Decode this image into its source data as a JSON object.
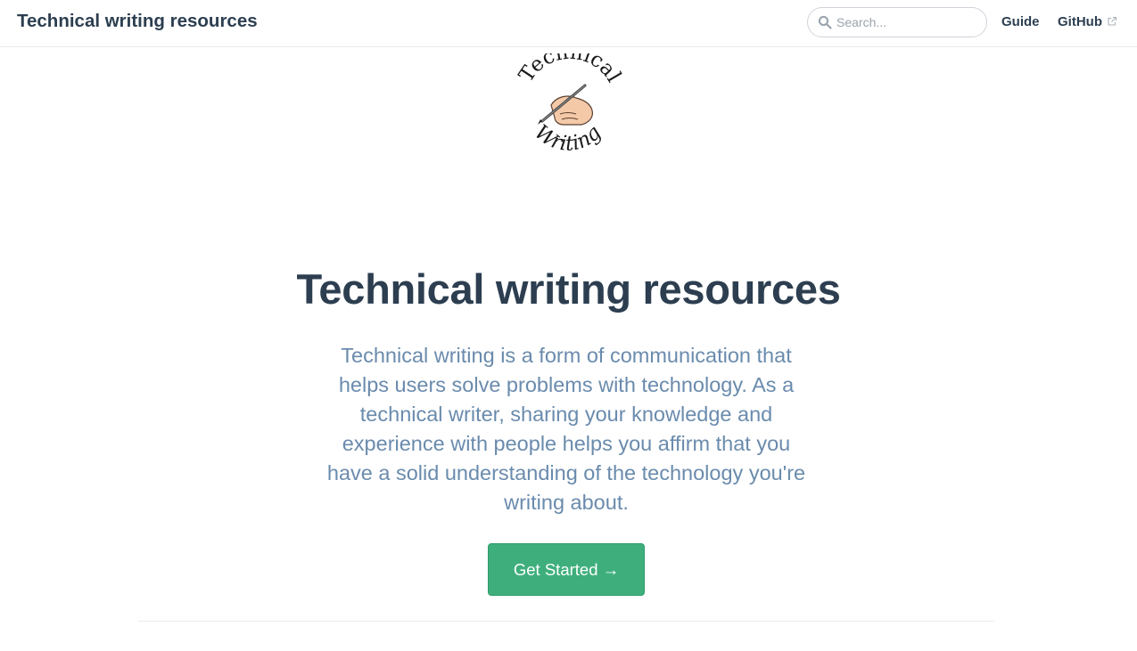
{
  "navbar": {
    "site_title": "Technical writing resources",
    "search": {
      "placeholder": "Search...",
      "value": "",
      "icon": "search-icon"
    },
    "links": [
      {
        "label": "Guide"
      },
      {
        "label": "GitHub",
        "icon": "external-link-icon"
      }
    ]
  },
  "hero": {
    "logo": {
      "arc_top_text": "Technical",
      "arc_bottom_text": "Writing",
      "icon": "writing-hand-icon"
    },
    "title": "Technical writing resources",
    "description": "Technical writing is a form of communication that helps users solve problems with technology. As a technical writer, sharing your knowledge and experience with people helps you affirm that you have a solid understanding of the technology you're writing about.",
    "action_label": "Get Started →"
  },
  "colors": {
    "text_primary": "#2c3e50",
    "text_secondary": "#6a8bad",
    "accent": "#3eaf7c",
    "border": "#eaecef"
  }
}
